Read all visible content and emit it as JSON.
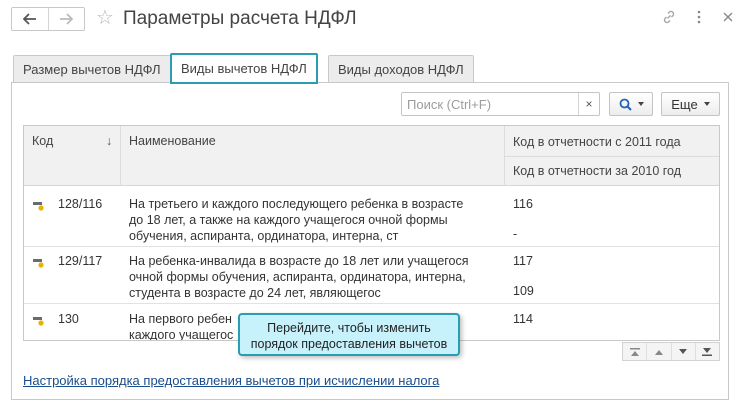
{
  "header": {
    "title": "Параметры расчета НДФЛ",
    "back_icon": "arrow-left-icon",
    "forward_icon": "arrow-right-icon",
    "favorite_icon": "star-icon",
    "link_icon": "link-icon",
    "more_icon": "vertical-dots-icon",
    "close_icon": "close-icon"
  },
  "tabs": [
    {
      "label": "Размер вычетов НДФЛ",
      "active": false
    },
    {
      "label": "Виды вычетов НДФЛ",
      "active": true
    },
    {
      "label": "Виды доходов НДФЛ",
      "active": false
    }
  ],
  "toolbar": {
    "search_placeholder": "Поиск (Ctrl+F)",
    "search_value": "",
    "clear_label": "×",
    "find_icon": "search-icon",
    "more_label": "Еще"
  },
  "table": {
    "columns": {
      "code": "Код",
      "sort_indicator": "↓",
      "name": "Наименование",
      "code_2011": "Код в отчетности с 2011 года",
      "code_2010": "Код в отчетности за 2010 год"
    },
    "rows": [
      {
        "code": "128/116",
        "name": "На третьего и каждого последующего ребенка в возрасте до 18 лет, а также на каждого учащегося очной формы обучения, аспиранта, ординатора, интерна, ст",
        "name_lines": [
          "На третьего и каждого последующего ребенка в возрасте",
          "до 18 лет, а также на каждого учащегося очной формы",
          "обучения, аспиранта, ординатора, интерна, ст"
        ],
        "code_2011": "116",
        "code_2010": "-"
      },
      {
        "code": "129/117",
        "name": "На ребенка-инвалида в возрасте до 18 лет или учащегося очной формы обучения, аспиранта, ординатора, интерна, студента в возрасте до 24 лет, являющегос",
        "name_lines": [
          "На ребенка-инвалида в возрасте до 18 лет или учащегося",
          "очной формы обучения, аспиранта, ординатора, интерна,",
          "студента в возрасте до 24 лет, являющегос"
        ],
        "code_2011": "117",
        "code_2010": "109"
      },
      {
        "code": "130",
        "name_lines": [
          "На первого ребен",
          "каждого учащегос"
        ],
        "code_2011": "114",
        "code_2010": ""
      }
    ]
  },
  "tooltip": {
    "lines": [
      "Перейдите, чтобы изменить",
      "порядок предоставления вычетов"
    ]
  },
  "move_buttons": [
    "move-first-icon",
    "move-up-icon",
    "move-down-icon",
    "move-last-icon"
  ],
  "footer_link": "Настройка порядка предоставления вычетов при исчислении налога",
  "colors": {
    "accent": "#2a9db0",
    "tooltip_bg": "#c7f1fb",
    "link": "#1a4d8c",
    "row_icon": "#e4b400"
  }
}
